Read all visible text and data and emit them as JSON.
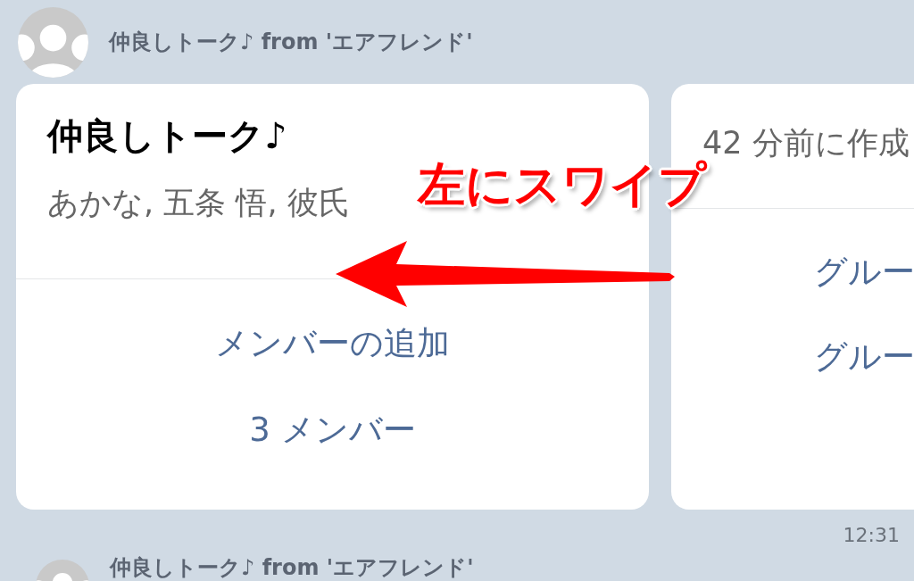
{
  "messages": [
    {
      "sender": "仲良しトーク♪ from 'エアフレンド'",
      "cards": [
        {
          "kind": "group",
          "title": "仲良しトーク♪",
          "members": "あかな, 五条 悟, 彼氏",
          "actions": [
            "メンバーの追加",
            "3 メンバー"
          ]
        },
        {
          "kind": "info",
          "created": "42 分前に作成",
          "actions": [
            "グルー",
            "グルー"
          ]
        }
      ],
      "time": "12:31"
    },
    {
      "sender": "仲良しトーク♪ from 'エアフレンド'"
    }
  ],
  "annotation": {
    "text": "左にスワイプ"
  }
}
